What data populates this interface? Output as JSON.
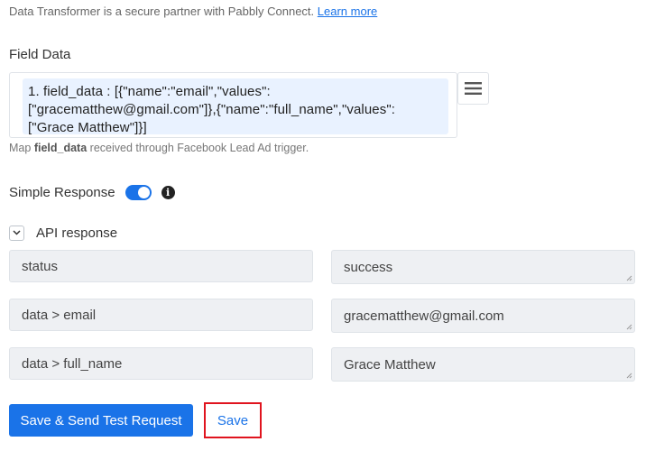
{
  "top_note": {
    "text": "Data Transformer is a secure partner with Pabbly Connect.",
    "link": "Learn more"
  },
  "field_data": {
    "label": "Field Data",
    "chip_line1": "1. field_data : [{\"name\":\"email\",\"values\":",
    "chip_line2": "[\"gracematthew@gmail.com\"]},{\"name\":\"full_name\",\"values\":",
    "chip_line3": "[\"Grace Matthew\"]}]",
    "hint_prefix": "Map",
    "hint_bold": "field_data",
    "hint_suffix": "received through Facebook Lead Ad trigger.",
    "menu_icon": "hamburger-menu-icon"
  },
  "simple_response": {
    "label": "Simple Response",
    "enabled": true,
    "toggle_color": "#1a73e8",
    "info_icon": "info-icon"
  },
  "api_response": {
    "label": "API response",
    "collapse_icon": "chevron-down-icon",
    "rows": [
      {
        "key": "status",
        "value": "success"
      },
      {
        "key": "data > email",
        "value": "gracematthew@gmail.com"
      },
      {
        "key": "data > full_name",
        "value": "Grace Matthew"
      }
    ]
  },
  "actions": {
    "send_label": "Save & Send Test Request",
    "save_label": "Save",
    "accent": "#1a73e8",
    "highlight": "#e0141e"
  }
}
